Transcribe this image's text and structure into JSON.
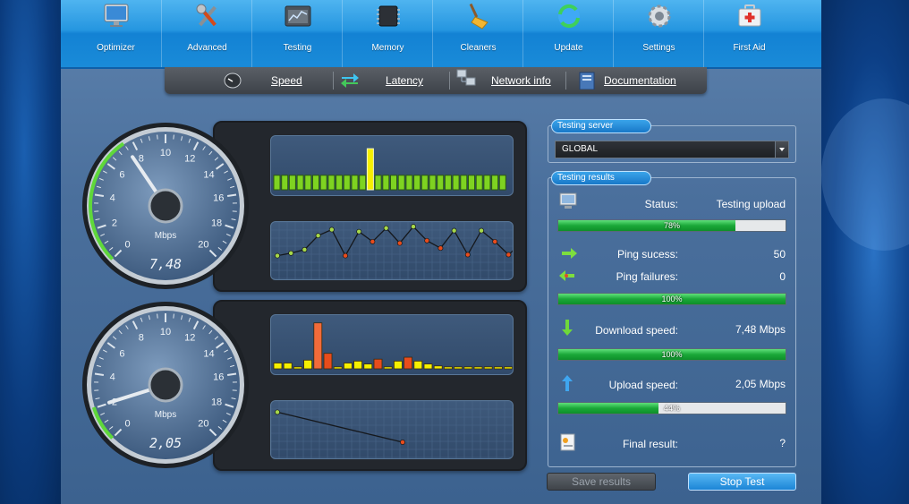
{
  "toolbar": {
    "items": [
      {
        "label": "Optimizer",
        "icon": "monitor-icon"
      },
      {
        "label": "Advanced",
        "icon": "tools-icon"
      },
      {
        "label": "Testing",
        "icon": "chart-window-icon"
      },
      {
        "label": "Memory",
        "icon": "memory-chip-icon"
      },
      {
        "label": "Cleaners",
        "icon": "broom-icon"
      },
      {
        "label": "Update",
        "icon": "refresh-globe-icon"
      },
      {
        "label": "Settings",
        "icon": "gear-icon"
      },
      {
        "label": "First Aid",
        "icon": "first-aid-kit-icon"
      }
    ]
  },
  "subnav": {
    "items": [
      {
        "label": "Speed",
        "icon": "speedometer-icon"
      },
      {
        "label": "Latency",
        "icon": "swap-arrows-icon"
      },
      {
        "label": "Network info",
        "icon": "network-computers-icon"
      },
      {
        "label": "Documentation",
        "icon": "document-icon"
      }
    ]
  },
  "gauges": {
    "scale": [
      "0",
      "2",
      "4",
      "6",
      "8",
      "10",
      "12",
      "14",
      "16",
      "18",
      "20"
    ],
    "unit": "Mbps",
    "download": {
      "readout": "7,48",
      "value": 7.48,
      "bars": [
        3,
        3,
        3,
        3,
        3,
        3,
        3,
        3,
        3,
        3,
        3,
        3,
        3,
        3,
        3,
        3,
        3,
        3,
        3,
        3,
        3,
        3,
        3,
        3,
        3,
        3,
        3,
        3,
        3,
        3
      ],
      "highlight_index": 12,
      "highlight_height": 8.5,
      "line": [
        4,
        4.5,
        5.2,
        8,
        9.2,
        4,
        8.8,
        6.8,
        9.5,
        6.5,
        9.8,
        7,
        5.5,
        9,
        4.2,
        9,
        6.8,
        4.2,
        6.6
      ]
    },
    "upload": {
      "readout": "2,05",
      "value": 2.05,
      "bars": [
        {
          "h": 1.2,
          "c": "yellow"
        },
        {
          "h": 1.2,
          "c": "yellow"
        },
        {
          "h": 0.4,
          "c": "yellow"
        },
        {
          "h": 1.8,
          "c": "yellow"
        },
        {
          "h": 9.5,
          "c": "orange"
        },
        {
          "h": 3.2,
          "c": "red"
        },
        {
          "h": 0.4,
          "c": "yellow"
        },
        {
          "h": 1.2,
          "c": "yellow"
        },
        {
          "h": 1.6,
          "c": "yellow"
        },
        {
          "h": 1.0,
          "c": "yellow"
        },
        {
          "h": 2.0,
          "c": "red"
        },
        {
          "h": 0.4,
          "c": "yellow"
        },
        {
          "h": 1.6,
          "c": "yellow"
        },
        {
          "h": 2.4,
          "c": "red"
        },
        {
          "h": 1.6,
          "c": "yellow"
        },
        {
          "h": 1.0,
          "c": "yellow"
        },
        {
          "h": 0.6,
          "c": "yellow"
        },
        {
          "h": 0.4,
          "c": "yellow"
        },
        {
          "h": 0.4,
          "c": "yellow"
        },
        {
          "h": 0.4,
          "c": "yellow"
        },
        {
          "h": 0.4,
          "c": "yellow"
        },
        {
          "h": 0.4,
          "c": "yellow"
        },
        {
          "h": 0.4,
          "c": "yellow"
        },
        {
          "h": 0.4,
          "c": "yellow"
        }
      ],
      "line": [
        8.5,
        2.5
      ]
    }
  },
  "server": {
    "title": "Testing server",
    "selected": "GLOBAL"
  },
  "results": {
    "title": "Testing results",
    "status_label": "Status:",
    "status_value": "Testing upload",
    "status_progress": 0.78,
    "status_progress_text": "78%",
    "ping_success_label": "Ping sucess:",
    "ping_success_value": "50",
    "ping_failures_label": "Ping failures:",
    "ping_failures_value": "0",
    "ping_progress": 1.0,
    "ping_progress_text": "100%",
    "download_label": "Download speed:",
    "download_value": "7,48 Mbps",
    "download_progress": 1.0,
    "download_progress_text": "100%",
    "upload_label": "Upload speed:",
    "upload_value": "2,05 Mbps",
    "upload_progress": 0.44,
    "upload_progress_text": "44%",
    "final_label": "Final result:",
    "final_value": "?"
  },
  "buttons": {
    "save": "Save results",
    "stop": "Stop Test"
  },
  "colors": {
    "accent": "#1c85d6",
    "progress_green": "#1aa838",
    "bar_green": "#7ed321",
    "bar_yellow": "#f6f000",
    "bar_red": "#e84c1c"
  }
}
